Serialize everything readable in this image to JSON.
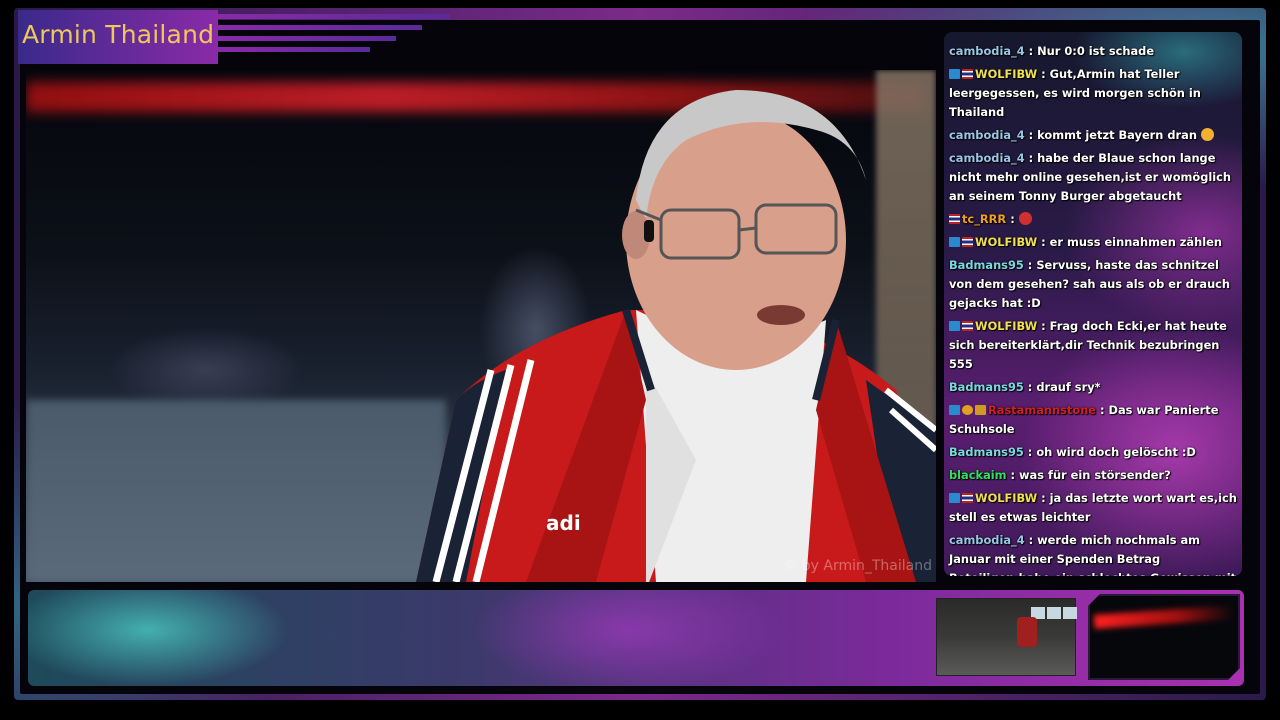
{
  "overlay": {
    "title": "Armin Thailand",
    "watermark": "© by Armin_Thailand"
  },
  "colors": {
    "title_text": "#f0c85a",
    "frame_accent": "#8a2aa8",
    "frame_teal": "#50c8d2"
  },
  "chat": {
    "messages": [
      {
        "badges": [],
        "user": "cambodia_4",
        "user_color": "#9ac6e6",
        "text": ": Nur 0:0 ist schade",
        "emote": ""
      },
      {
        "badges": [
          "blue",
          "flag"
        ],
        "user": "WOLFIBW",
        "user_color": "#f0e050",
        "text": ": Gut,Armin hat Teller leergegessen, es wird morgen schön in Thailand",
        "emote": ""
      },
      {
        "badges": [],
        "user": "cambodia_4",
        "user_color": "#9ac6e6",
        "text": ": kommt jetzt Bayern dran",
        "emote": "smile-emote"
      },
      {
        "badges": [],
        "user": "cambodia_4",
        "user_color": "#9ac6e6",
        "text": ": habe der Blaue schon lange nicht mehr online gesehen,ist er womöglich an seinem Tonny Burger abgetaucht",
        "emote": ""
      },
      {
        "badges": [
          "flag"
        ],
        "user": "tc_RRR",
        "user_color": "#f0a020",
        "text": ":",
        "emote": "red-emote"
      },
      {
        "badges": [
          "blue",
          "flag"
        ],
        "user": "WOLFIBW",
        "user_color": "#f0e050",
        "text": ": er muss einnahmen zählen",
        "emote": ""
      },
      {
        "badges": [],
        "user": "Badmans95",
        "user_color": "#7ad8e0",
        "text": ": Servuss, haste das schnitzel von dem gesehen? sah aus als ob er drauch gejacks hat :D",
        "emote": ""
      },
      {
        "badges": [
          "blue",
          "flag"
        ],
        "user": "WOLFIBW",
        "user_color": "#f0e050",
        "text": ": Frag doch Ecki,er hat heute sich bereiterklärt,dir Technik bezubringen 555",
        "emote": ""
      },
      {
        "badges": [],
        "user": "Badmans95",
        "user_color": "#7ad8e0",
        "text": ": drauf sry*",
        "emote": ""
      },
      {
        "badges": [
          "blue",
          "gold",
          "crown"
        ],
        "user": "Rastamannstone",
        "user_color": "#d02020",
        "text": ": Das war Panierte Schuhsole",
        "emote": ""
      },
      {
        "badges": [],
        "user": "Badmans95",
        "user_color": "#7ad8e0",
        "text": ": oh wird doch gelöscht :D",
        "emote": ""
      },
      {
        "badges": [],
        "user": "blackaim",
        "user_color": "#30e060",
        "text": ": was für ein störsender?",
        "emote": ""
      },
      {
        "badges": [
          "blue",
          "flag"
        ],
        "user": "WOLFIBW",
        "user_color": "#f0e050",
        "text": ": ja das letzte wort wart es,ich stell es etwas leichter",
        "emote": ""
      },
      {
        "badges": [],
        "user": "cambodia_4",
        "user_color": "#9ac6e6",
        "text": ": werde mich nochmals am Januar mit einer Spenden Betrag Beteiligen,habe ein schlechtes Gewissen mit diesen Betrag der ich getätigt habe",
        "emote": ""
      }
    ]
  }
}
